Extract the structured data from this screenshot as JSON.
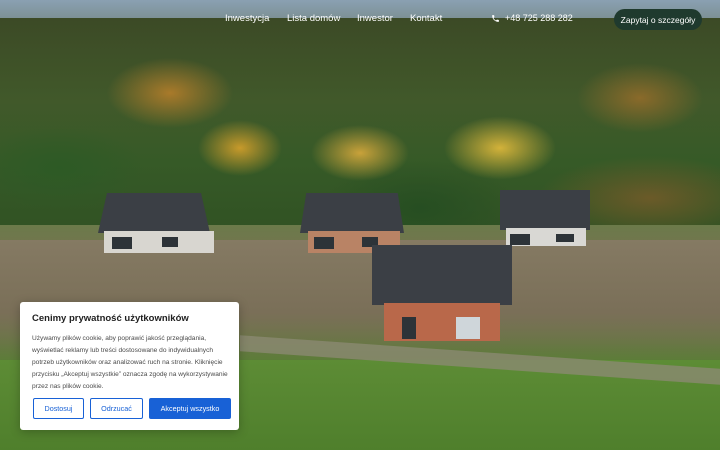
{
  "nav": {
    "links": [
      "Inwestycja",
      "Lista domów",
      "Inwestor",
      "Kontakt"
    ],
    "phone": "+48 725 288 282",
    "cta_label": "Zapytaj o szczegóły"
  },
  "cookie": {
    "title": "Cenimy prywatność użytkowników",
    "text": "Używamy plików cookie, aby poprawić jakość przeglądania, wyświetlać reklamy lub treści dostosowane do indywidualnych potrzeb użytkowników oraz analizować ruch na stronie. Kliknięcie przycisku „Akceptuj wszystkie” oznacza zgodę na wykorzystywanie przez nas plików cookie.",
    "buttons": {
      "customize": "Dostosuj",
      "reject": "Odrzucać",
      "accept": "Akceptuj wszystko"
    }
  },
  "colors": {
    "accent": "#1861d6",
    "cta_bg": "#1f3a2e"
  },
  "icons": {
    "phone": "phone-icon"
  }
}
